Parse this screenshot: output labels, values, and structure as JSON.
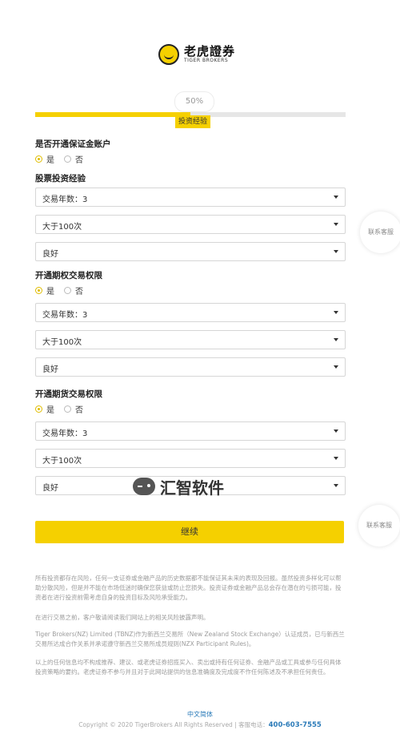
{
  "logo": {
    "name_cn": "老虎證券",
    "name_en": "TIGER BROKERS"
  },
  "progress": {
    "percent": 50,
    "label": "50%",
    "step_tag": "投资经验"
  },
  "margin": {
    "title": "是否开通保证金账户",
    "yes": "是",
    "no": "否",
    "selected": "yes"
  },
  "stock": {
    "title": "股票投资经验",
    "years": "交易年数：3",
    "count": "大于100次",
    "level": "良好"
  },
  "options": {
    "title": "开通期权交易权限",
    "yes": "是",
    "no": "否",
    "selected": "yes",
    "years": "交易年数：3",
    "count": "大于100次",
    "level": "良好"
  },
  "futures": {
    "title": "开通期货交易权限",
    "yes": "是",
    "no": "否",
    "selected": "yes",
    "years": "交易年数：3",
    "count": "大于100次",
    "level": "良好"
  },
  "side": {
    "contact1": "联系客服",
    "contact2": "联系客服"
  },
  "submit_label": "继续",
  "watermark": "汇智软件",
  "disclaimer": {
    "p1": "所有投资都存在风险，任何一支证券或金融产品的历史数据都不能保证其未来的表现及回报。虽然投资多样化可以帮助分散风险，但是并不能在市场低迷时确保您获益或防止您损失。投资证券或金融产品总会存在潜在的亏损可能，投资者在进行投资前需考虑自身的投资目标及风险承受能力。",
    "p2": "在进行交易之前，客户敬请阅读我们网站上的相关风险披露声明。",
    "p3": "Tiger Brokers(NZ) Limited (TBNZ)作为新西兰交易所（New Zealand Stock Exchange）认证成员，已与新西兰交易所达成合作关系并承诺遵守新西兰交易所成员规则(NZX Participant Rules)。",
    "p4": "以上的任何信息均不构成推荐、建议、或老虎证券招揽买入、卖出或持有任何证券、金融产品或工具或参与任何具体投资策略的要约。老虎证券不参与并且对于此网站提供的信息准确度及完成度不作任何陈述及不承担任何责任。"
  },
  "footer": {
    "lang": "中文简体",
    "copyright": "Copyright © 2020 TigerBrokers All Rights Reserved | 客服电话：",
    "phone": "400-603-7555"
  }
}
